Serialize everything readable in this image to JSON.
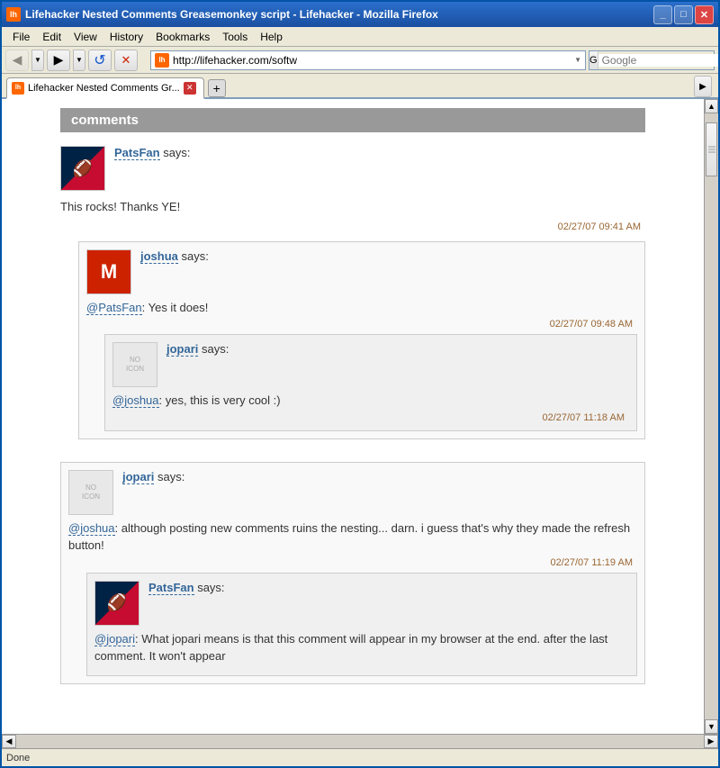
{
  "window": {
    "title": "Lifehacker Nested Comments Greasemonkey script - Lifehacker - Mozilla Firefox",
    "icon": "lh"
  },
  "menu": {
    "items": [
      "File",
      "Edit",
      "View",
      "History",
      "Bookmarks",
      "Tools",
      "Help"
    ]
  },
  "navbar": {
    "address": "http://lifehacker.com/softw",
    "search_placeholder": "Google"
  },
  "tab": {
    "label": "Lifehacker Nested Comments Gr...",
    "favicon": "lh"
  },
  "comments": {
    "header": "comments",
    "items": [
      {
        "id": "c1",
        "username": "PatsFan",
        "avatar_type": "patriots",
        "text": "This rocks! Thanks YE!",
        "timestamp": "02/27/07 09:41 AM",
        "replies": [
          {
            "id": "c2",
            "username": "joshua",
            "avatar_type": "mm",
            "mention": "@PatsFan",
            "text": ": Yes it does!",
            "timestamp": "02/27/07 09:48 AM",
            "replies": [
              {
                "id": "c3",
                "username": "jopari",
                "avatar_type": "blank",
                "mention": "@joshua",
                "text": ": yes, this is very cool :)",
                "timestamp": "02/27/07 11:18 AM"
              }
            ]
          }
        ]
      },
      {
        "id": "c4",
        "username": "jopari",
        "avatar_type": "blank",
        "mention": "@joshua",
        "text": ": although posting new comments ruins the nesting... darn. i guess that's why they made the refresh button!",
        "timestamp": "02/27/07 11:19 AM",
        "replies": [
          {
            "id": "c5",
            "username": "PatsFan",
            "avatar_type": "patriots",
            "mention": "@jopari",
            "text": ": What jopari means is that this comment will appear in my browser at the end. after the last comment. It won't appear",
            "timestamp": ""
          }
        ]
      }
    ]
  }
}
